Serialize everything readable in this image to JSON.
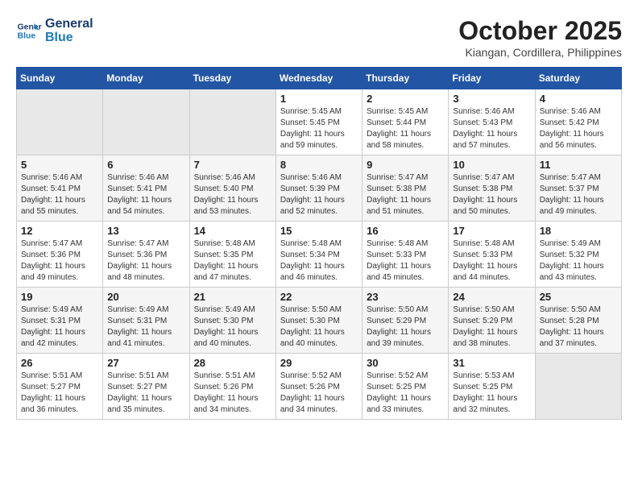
{
  "logo": {
    "line1": "General",
    "line2": "Blue"
  },
  "title": "October 2025",
  "subtitle": "Kiangan, Cordillera, Philippines",
  "days_of_week": [
    "Sunday",
    "Monday",
    "Tuesday",
    "Wednesday",
    "Thursday",
    "Friday",
    "Saturday"
  ],
  "weeks": [
    [
      {
        "day": "",
        "sunrise": "",
        "sunset": "",
        "daylight": ""
      },
      {
        "day": "",
        "sunrise": "",
        "sunset": "",
        "daylight": ""
      },
      {
        "day": "",
        "sunrise": "",
        "sunset": "",
        "daylight": ""
      },
      {
        "day": "1",
        "sunrise": "Sunrise: 5:45 AM",
        "sunset": "Sunset: 5:45 PM",
        "daylight": "Daylight: 11 hours and 59 minutes."
      },
      {
        "day": "2",
        "sunrise": "Sunrise: 5:45 AM",
        "sunset": "Sunset: 5:44 PM",
        "daylight": "Daylight: 11 hours and 58 minutes."
      },
      {
        "day": "3",
        "sunrise": "Sunrise: 5:46 AM",
        "sunset": "Sunset: 5:43 PM",
        "daylight": "Daylight: 11 hours and 57 minutes."
      },
      {
        "day": "4",
        "sunrise": "Sunrise: 5:46 AM",
        "sunset": "Sunset: 5:42 PM",
        "daylight": "Daylight: 11 hours and 56 minutes."
      }
    ],
    [
      {
        "day": "5",
        "sunrise": "Sunrise: 5:46 AM",
        "sunset": "Sunset: 5:41 PM",
        "daylight": "Daylight: 11 hours and 55 minutes."
      },
      {
        "day": "6",
        "sunrise": "Sunrise: 5:46 AM",
        "sunset": "Sunset: 5:41 PM",
        "daylight": "Daylight: 11 hours and 54 minutes."
      },
      {
        "day": "7",
        "sunrise": "Sunrise: 5:46 AM",
        "sunset": "Sunset: 5:40 PM",
        "daylight": "Daylight: 11 hours and 53 minutes."
      },
      {
        "day": "8",
        "sunrise": "Sunrise: 5:46 AM",
        "sunset": "Sunset: 5:39 PM",
        "daylight": "Daylight: 11 hours and 52 minutes."
      },
      {
        "day": "9",
        "sunrise": "Sunrise: 5:47 AM",
        "sunset": "Sunset: 5:38 PM",
        "daylight": "Daylight: 11 hours and 51 minutes."
      },
      {
        "day": "10",
        "sunrise": "Sunrise: 5:47 AM",
        "sunset": "Sunset: 5:38 PM",
        "daylight": "Daylight: 11 hours and 50 minutes."
      },
      {
        "day": "11",
        "sunrise": "Sunrise: 5:47 AM",
        "sunset": "Sunset: 5:37 PM",
        "daylight": "Daylight: 11 hours and 49 minutes."
      }
    ],
    [
      {
        "day": "12",
        "sunrise": "Sunrise: 5:47 AM",
        "sunset": "Sunset: 5:36 PM",
        "daylight": "Daylight: 11 hours and 49 minutes."
      },
      {
        "day": "13",
        "sunrise": "Sunrise: 5:47 AM",
        "sunset": "Sunset: 5:36 PM",
        "daylight": "Daylight: 11 hours and 48 minutes."
      },
      {
        "day": "14",
        "sunrise": "Sunrise: 5:48 AM",
        "sunset": "Sunset: 5:35 PM",
        "daylight": "Daylight: 11 hours and 47 minutes."
      },
      {
        "day": "15",
        "sunrise": "Sunrise: 5:48 AM",
        "sunset": "Sunset: 5:34 PM",
        "daylight": "Daylight: 11 hours and 46 minutes."
      },
      {
        "day": "16",
        "sunrise": "Sunrise: 5:48 AM",
        "sunset": "Sunset: 5:33 PM",
        "daylight": "Daylight: 11 hours and 45 minutes."
      },
      {
        "day": "17",
        "sunrise": "Sunrise: 5:48 AM",
        "sunset": "Sunset: 5:33 PM",
        "daylight": "Daylight: 11 hours and 44 minutes."
      },
      {
        "day": "18",
        "sunrise": "Sunrise: 5:49 AM",
        "sunset": "Sunset: 5:32 PM",
        "daylight": "Daylight: 11 hours and 43 minutes."
      }
    ],
    [
      {
        "day": "19",
        "sunrise": "Sunrise: 5:49 AM",
        "sunset": "Sunset: 5:31 PM",
        "daylight": "Daylight: 11 hours and 42 minutes."
      },
      {
        "day": "20",
        "sunrise": "Sunrise: 5:49 AM",
        "sunset": "Sunset: 5:31 PM",
        "daylight": "Daylight: 11 hours and 41 minutes."
      },
      {
        "day": "21",
        "sunrise": "Sunrise: 5:49 AM",
        "sunset": "Sunset: 5:30 PM",
        "daylight": "Daylight: 11 hours and 40 minutes."
      },
      {
        "day": "22",
        "sunrise": "Sunrise: 5:50 AM",
        "sunset": "Sunset: 5:30 PM",
        "daylight": "Daylight: 11 hours and 40 minutes."
      },
      {
        "day": "23",
        "sunrise": "Sunrise: 5:50 AM",
        "sunset": "Sunset: 5:29 PM",
        "daylight": "Daylight: 11 hours and 39 minutes."
      },
      {
        "day": "24",
        "sunrise": "Sunrise: 5:50 AM",
        "sunset": "Sunset: 5:29 PM",
        "daylight": "Daylight: 11 hours and 38 minutes."
      },
      {
        "day": "25",
        "sunrise": "Sunrise: 5:50 AM",
        "sunset": "Sunset: 5:28 PM",
        "daylight": "Daylight: 11 hours and 37 minutes."
      }
    ],
    [
      {
        "day": "26",
        "sunrise": "Sunrise: 5:51 AM",
        "sunset": "Sunset: 5:27 PM",
        "daylight": "Daylight: 11 hours and 36 minutes."
      },
      {
        "day": "27",
        "sunrise": "Sunrise: 5:51 AM",
        "sunset": "Sunset: 5:27 PM",
        "daylight": "Daylight: 11 hours and 35 minutes."
      },
      {
        "day": "28",
        "sunrise": "Sunrise: 5:51 AM",
        "sunset": "Sunset: 5:26 PM",
        "daylight": "Daylight: 11 hours and 34 minutes."
      },
      {
        "day": "29",
        "sunrise": "Sunrise: 5:52 AM",
        "sunset": "Sunset: 5:26 PM",
        "daylight": "Daylight: 11 hours and 34 minutes."
      },
      {
        "day": "30",
        "sunrise": "Sunrise: 5:52 AM",
        "sunset": "Sunset: 5:25 PM",
        "daylight": "Daylight: 11 hours and 33 minutes."
      },
      {
        "day": "31",
        "sunrise": "Sunrise: 5:53 AM",
        "sunset": "Sunset: 5:25 PM",
        "daylight": "Daylight: 11 hours and 32 minutes."
      },
      {
        "day": "",
        "sunrise": "",
        "sunset": "",
        "daylight": ""
      }
    ]
  ]
}
